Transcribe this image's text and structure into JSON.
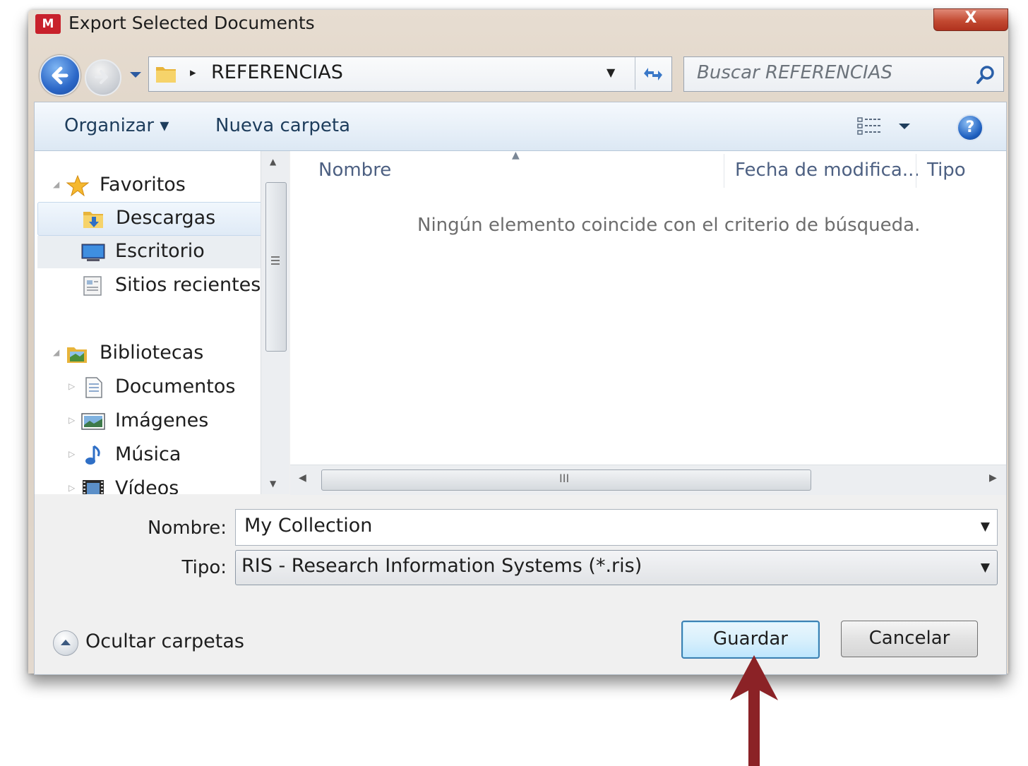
{
  "window": {
    "title": "Export Selected Documents",
    "app_icon_text": "M",
    "close_label": "X"
  },
  "navigation": {
    "breadcrumb_arrow": "▸",
    "current_folder": "REFERENCIAS",
    "search_placeholder": "Buscar REFERENCIAS"
  },
  "toolbar": {
    "organize_label": "Organizar ▾",
    "new_folder_label": "Nueva carpeta",
    "help_label": "?"
  },
  "nav_pane": {
    "favorites": {
      "label": "Favoritos",
      "items": [
        {
          "label": "Descargas"
        },
        {
          "label": "Escritorio"
        },
        {
          "label": "Sitios recientes"
        }
      ]
    },
    "libraries": {
      "label": "Bibliotecas",
      "items": [
        {
          "label": "Documentos"
        },
        {
          "label": "Imágenes"
        },
        {
          "label": "Música"
        },
        {
          "label": "Vídeos"
        }
      ]
    }
  },
  "file_list": {
    "columns": [
      "Nombre",
      "Fecha de modifica...",
      "Tipo"
    ],
    "empty_message": "Ningún elemento coincide con el criterio de búsqueda.",
    "scroll_grip": "III"
  },
  "form": {
    "filename_label": "Nombre:",
    "filename_value": "My Collection",
    "filetype_label": "Tipo:",
    "filetype_value": "RIS - Research Information Systems (*.ris)"
  },
  "footer": {
    "hide_folders_label": "Ocultar carpetas",
    "save_label": "Guardar",
    "cancel_label": "Cancelar"
  },
  "colors": {
    "annotation_arrow": "#8b2226",
    "primary_button_border": "#3c7fb1",
    "close_button": "#c34a32"
  }
}
